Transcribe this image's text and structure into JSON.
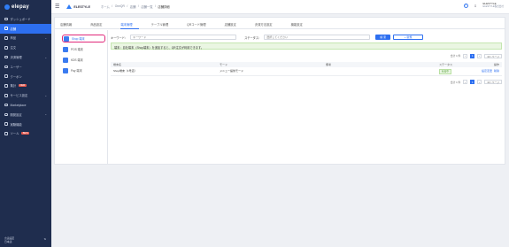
{
  "sidebar": {
    "logo": "elepay",
    "items": [
      {
        "label": "ダッシュボード",
        "icon": "dashboard-icon",
        "chevron": false,
        "badge": ""
      },
      {
        "label": "店舗",
        "icon": "store-icon",
        "chevron": false,
        "badge": "",
        "active": true
      },
      {
        "label": "商品",
        "icon": "box-icon",
        "chevron": true,
        "badge": ""
      },
      {
        "label": "注文",
        "icon": "order-icon",
        "chevron": false,
        "badge": ""
      },
      {
        "label": "決済管理",
        "icon": "card-icon",
        "chevron": true,
        "badge": ""
      },
      {
        "label": "ユーザー",
        "icon": "user-icon",
        "chevron": false,
        "badge": ""
      },
      {
        "label": "クーポン",
        "icon": "coupon-icon",
        "chevron": false,
        "badge": ""
      },
      {
        "label": "集計",
        "icon": "chart-icon",
        "chevron": false,
        "badge": "NEW"
      },
      {
        "label": "サービス設定",
        "icon": "gear-icon",
        "chevron": true,
        "badge": ""
      },
      {
        "label": "Marketplace",
        "icon": "grid-icon",
        "chevron": false,
        "badge": ""
      },
      {
        "label": "開発設定",
        "icon": "code-icon",
        "chevron": true,
        "badge": ""
      },
      {
        "label": "実験機能",
        "icon": "flask-icon",
        "chevron": false,
        "badge": ""
      },
      {
        "label": "ツール",
        "icon": "tool-icon",
        "chevron": false,
        "badge": "BETA"
      }
    ],
    "footer": {
      "line1": "言語設定",
      "line2": "日本語"
    }
  },
  "topbar": {
    "brand": "ELESTYLE",
    "breadcrumb": [
      "ホーム",
      "OneQR",
      "店舗",
      "店舗一覧",
      "店舗詳細"
    ],
    "user_name": "ELESTYLE",
    "user_sub": "ELESTYLE株式会社"
  },
  "tabs": [
    "店舗情報",
    "商品設定",
    "端末管理",
    "テーブル管理",
    "QRコード管理",
    "店舗設定",
    "決済方法設定",
    "機能設定"
  ],
  "active_tab": 2,
  "devices": [
    {
      "label": "Shop 端末",
      "active": true
    },
    {
      "label": "POS 端末"
    },
    {
      "label": "KDS 端末"
    },
    {
      "label": "Pay 端末"
    }
  ],
  "filter": {
    "keyword_label": "キーワード：",
    "keyword_placeholder": "キーワード",
    "status_label": "ステータス：",
    "status_placeholder": "選択してください",
    "search_label": "検 索",
    "new_label": "+ 新規"
  },
  "notice": "端末：自社端末（Shop端末）を追加すると、QR注文が利用できます。",
  "pager": {
    "total": "合計 1 件",
    "page": "1",
    "per_page": "10 / ページ"
  },
  "table": {
    "headers": [
      "端末名",
      "モード",
      "備考",
      "ステータス",
      "操作"
    ],
    "rows": [
      {
        "name": "Shop端末（1号店）",
        "mode": "メニュー提供モード",
        "note": "",
        "status": "有効中",
        "actions": [
          "設定変更",
          "削除"
        ]
      }
    ]
  },
  "colors": {
    "sidebar": "#1f2d4e",
    "accent": "#2d6ff0",
    "highlight": "#e0287a"
  }
}
